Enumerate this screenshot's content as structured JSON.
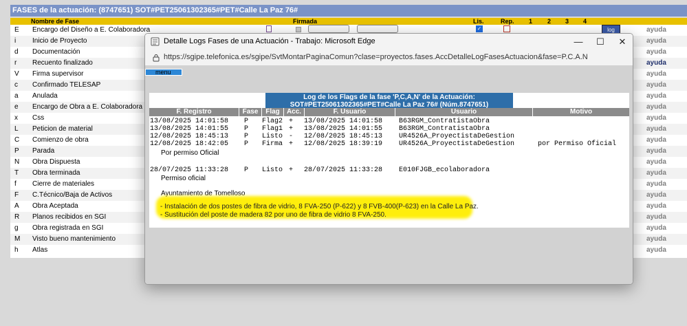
{
  "background": {
    "title": "FASES de la actuación: (8747651) SOT#PET25061302365#PET#Calle La Paz 76#",
    "headers": {
      "nombre": "Nombre de Fase",
      "firmada": "Firmada",
      "lis": "Lis.",
      "rep": "Rep.",
      "c1": "1",
      "c2": "2",
      "c3": "3",
      "c4": "4"
    },
    "log_button": "log",
    "rows": [
      {
        "code": "E",
        "name": "Encargo del Diseño a E. Colaboradora",
        "ayuda": "ayuda"
      },
      {
        "code": "i",
        "name": "Inicio de Proyecto",
        "ayuda": "ayuda"
      },
      {
        "code": "d",
        "name": "Documentación",
        "ayuda": "ayuda"
      },
      {
        "code": "r",
        "name": "Recuento finalizado",
        "ayuda": "ayuda"
      },
      {
        "code": "V",
        "name": "Firma supervisor",
        "ayuda": "ayuda"
      },
      {
        "code": "c",
        "name": "Confirmado TELESAP",
        "ayuda": "ayuda"
      },
      {
        "code": "a",
        "name": "Anulada",
        "ayuda": "ayuda"
      },
      {
        "code": "e",
        "name": "Encargo de Obra a E. Colaboradora",
        "ayuda": "ayuda"
      },
      {
        "code": "x",
        "name": "Css",
        "ayuda": "ayuda"
      },
      {
        "code": "L",
        "name": "Peticion de material",
        "ayuda": "ayuda"
      },
      {
        "code": "C",
        "name": "Comienzo de obra",
        "ayuda": "ayuda"
      },
      {
        "code": "P",
        "name": "Parada",
        "ayuda": "ayuda"
      },
      {
        "code": "N",
        "name": "Obra Dispuesta",
        "ayuda": "ayuda"
      },
      {
        "code": "T",
        "name": "Obra terminada",
        "ayuda": "ayuda"
      },
      {
        "code": "f",
        "name": "Cierre de materiales",
        "ayuda": "ayuda"
      },
      {
        "code": "F",
        "name": "C.Técnico/Baja de Activos",
        "ayuda": "ayuda"
      },
      {
        "code": "A",
        "name": "Obra Aceptada",
        "ayuda": "ayuda"
      },
      {
        "code": "R",
        "name": "Planos recibidos en SGI",
        "ayuda": "ayuda"
      },
      {
        "code": "g",
        "name": "Obra registrada en SGI",
        "ayuda": "ayuda"
      },
      {
        "code": "M",
        "name": "Visto bueno mantenimiento",
        "ayuda": "ayuda"
      },
      {
        "code": "h",
        "name": "Atlas",
        "ayuda": "ayuda"
      }
    ]
  },
  "window": {
    "title": "Detalle Logs Fases de una Actuación - Trabajo: Microsoft Edge",
    "url": "https://sgipe.telefonica.es/sgipe/SvtMontarPaginaComun?clase=proyectos.fases.AccDetalleLogFasesActuacion&fase=P.C.A.N",
    "minimize": "—",
    "maximize": "☐",
    "close": "✕"
  },
  "content": {
    "menu_label": "menu",
    "log_title_line1": "Log de los Flags de la fase 'P,C,A,N' de la Actuación:",
    "log_title_line2": "SOT#PET25061302365#PET#Calle La Paz 76# (Núm.8747651)",
    "columns": {
      "registro": "F. Registro",
      "fase": "Fase",
      "flag": "Flag",
      "acc": "Acc.",
      "f_usuario": "F. Usuario",
      "usuario": "Usuario",
      "motivo": "Motivo"
    },
    "entries": [
      {
        "registro": "13/08/2025 14:01:58",
        "fase": "P",
        "flag": "Flag2",
        "acc": "+",
        "f_usuario": "13/08/2025 14:01:58",
        "usuario": "B63RGM_ContratistaObra",
        "motivo": ""
      },
      {
        "registro": "13/08/2025 14:01:55",
        "fase": "P",
        "flag": "Flag1",
        "acc": "+",
        "f_usuario": "13/08/2025 14:01:55",
        "usuario": "B63RGM_ContratistaObra",
        "motivo": ""
      },
      {
        "registro": "12/08/2025 18:45:13",
        "fase": "P",
        "flag": "Listo",
        "acc": "-",
        "f_usuario": "12/08/2025 18:45:13",
        "usuario": "UR4526A_ProyectistaDeGestion",
        "motivo": ""
      },
      {
        "registro": "12/08/2025 18:42:05",
        "fase": "P",
        "flag": "Firma",
        "acc": "+",
        "f_usuario": "12/08/2025 18:39:19",
        "usuario": "UR4526A_ProyectistaDeGestion",
        "motivo": "por Permiso Oficial"
      },
      {
        "registro": "28/07/2025 11:33:28",
        "fase": "P",
        "flag": "Listo",
        "acc": "+",
        "f_usuario": "28/07/2025 11:33:28",
        "usuario": "E010FJGB_ecolaboradora",
        "motivo": ""
      }
    ],
    "note_permiso_oficial": "Por permiso Oficial",
    "note_permiso": "Permiso oficial",
    "note_ayuntamiento": "Ayuntamiento de Tomelloso",
    "note_line1": "- Instalación de dos postes de fibra de vidrio, 8 FVA-250 (P-622) y 8 FVB-400(P-623) en la Calle La Paz.",
    "note_line2": "- Sustitución del poste de madera 82 por uno de fibra de vidrio 8 FVA-250."
  }
}
